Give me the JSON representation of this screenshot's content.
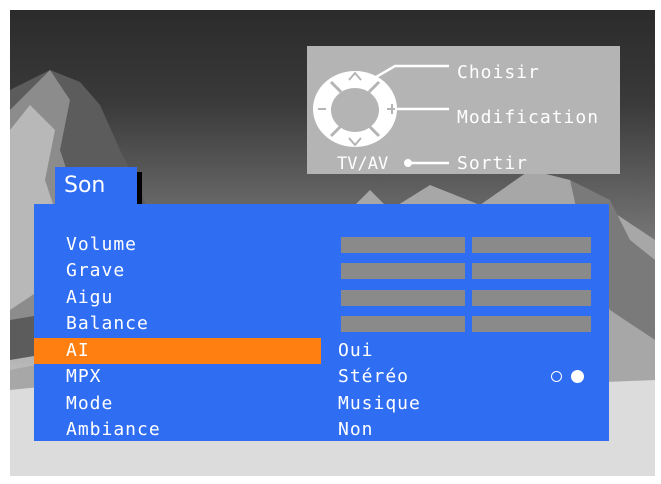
{
  "remote_legend": {
    "choose_label": "Choisir",
    "modify_label": "Modification",
    "exit_label": "Sortir",
    "tvav_label": "TV/AV",
    "up_symbol": "^",
    "down_symbol": "v",
    "minus_symbol": "−",
    "plus_symbol": "+"
  },
  "menu": {
    "title": "Son",
    "items": [
      {
        "label": "Volume",
        "value_type": "bar"
      },
      {
        "label": "Grave",
        "value_type": "bar"
      },
      {
        "label": "Aigu",
        "value_type": "bar"
      },
      {
        "label": "Balance",
        "value_type": "bar"
      },
      {
        "label": "AI",
        "value": "Oui",
        "selected": true
      },
      {
        "label": "MPX",
        "value": "Stéréo",
        "indicator": [
          "circle-open-icon",
          "circle-filled-icon"
        ]
      },
      {
        "label": "Mode",
        "value": "Musique"
      },
      {
        "label": "Ambiance",
        "value": "Non"
      }
    ]
  },
  "colors": {
    "panel_blue": "#2f6ef2",
    "highlight_orange": "#ff7f10",
    "bar_gray": "#8a8a8a",
    "legend_gray": "#b4b4b4"
  }
}
